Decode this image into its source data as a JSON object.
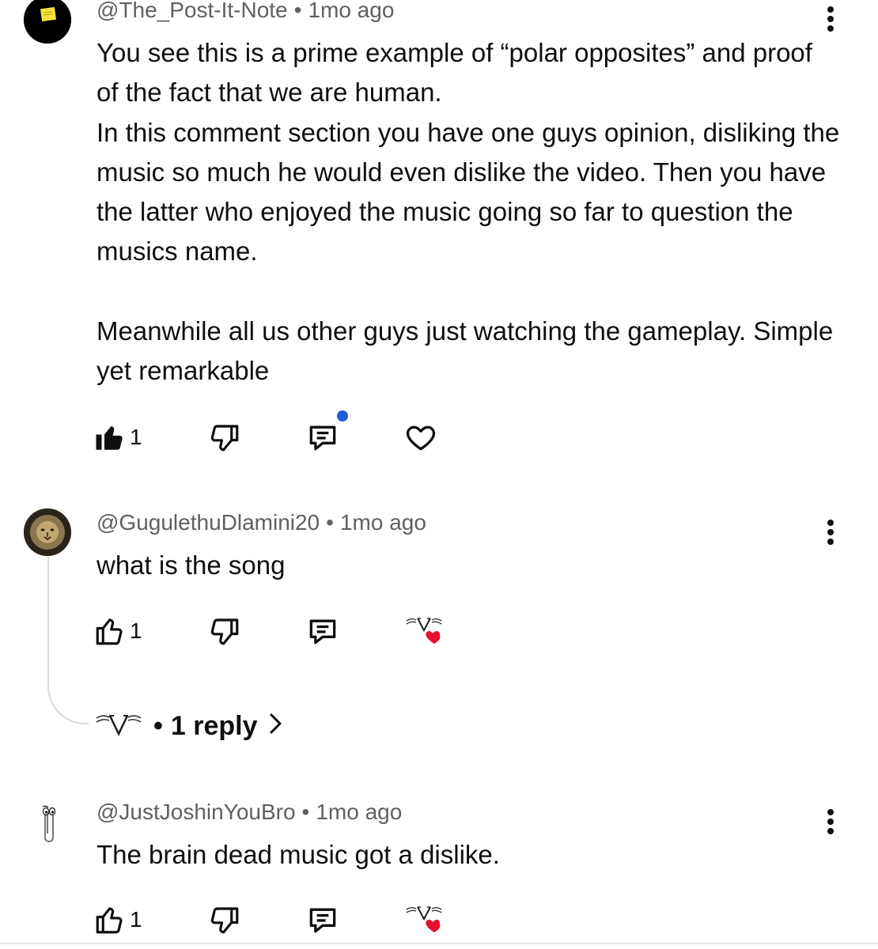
{
  "comments": [
    {
      "author": "@The_Post-It-Note",
      "separator": "•",
      "time": "1mo ago",
      "text": "You see this is a prime example of “polar opposites” and proof of the fact that we are human.\nIn this comment section you have one guys opinion, disliking the music so much he would even dislike the video. Then you have the latter who enjoyed the music going so far to question the musics name.\n\nMeanwhile all us other guys just watching the gameplay. Simple yet remarkable",
      "likes": "1",
      "liked": true,
      "avatar_icon": "sticky-note-avatar",
      "heart_icon": "heart-outline-icon"
    },
    {
      "author": "@GugulethuDlamini20",
      "separator": "•",
      "time": "1mo ago",
      "text": "what is the song",
      "likes": "1",
      "liked": false,
      "avatar_icon": "lion-avatar",
      "heart_icon": "creator-heart-icon",
      "replies": {
        "separator": "•",
        "label": "1 reply",
        "chevron": "›"
      }
    },
    {
      "author": "@JustJoshinYouBro",
      "separator": "•",
      "time": "1mo ago",
      "text": "The brain dead music got a dislike.",
      "likes": "1",
      "liked": false,
      "avatar_icon": "paperclip-avatar",
      "heart_icon": "creator-heart-icon"
    }
  ],
  "colors": {
    "text": "#0f0f0f",
    "meta": "#606060",
    "heart": "#e8112d",
    "notification_dot": "#1a5fd6",
    "sticky_note": "#f7e13a"
  }
}
